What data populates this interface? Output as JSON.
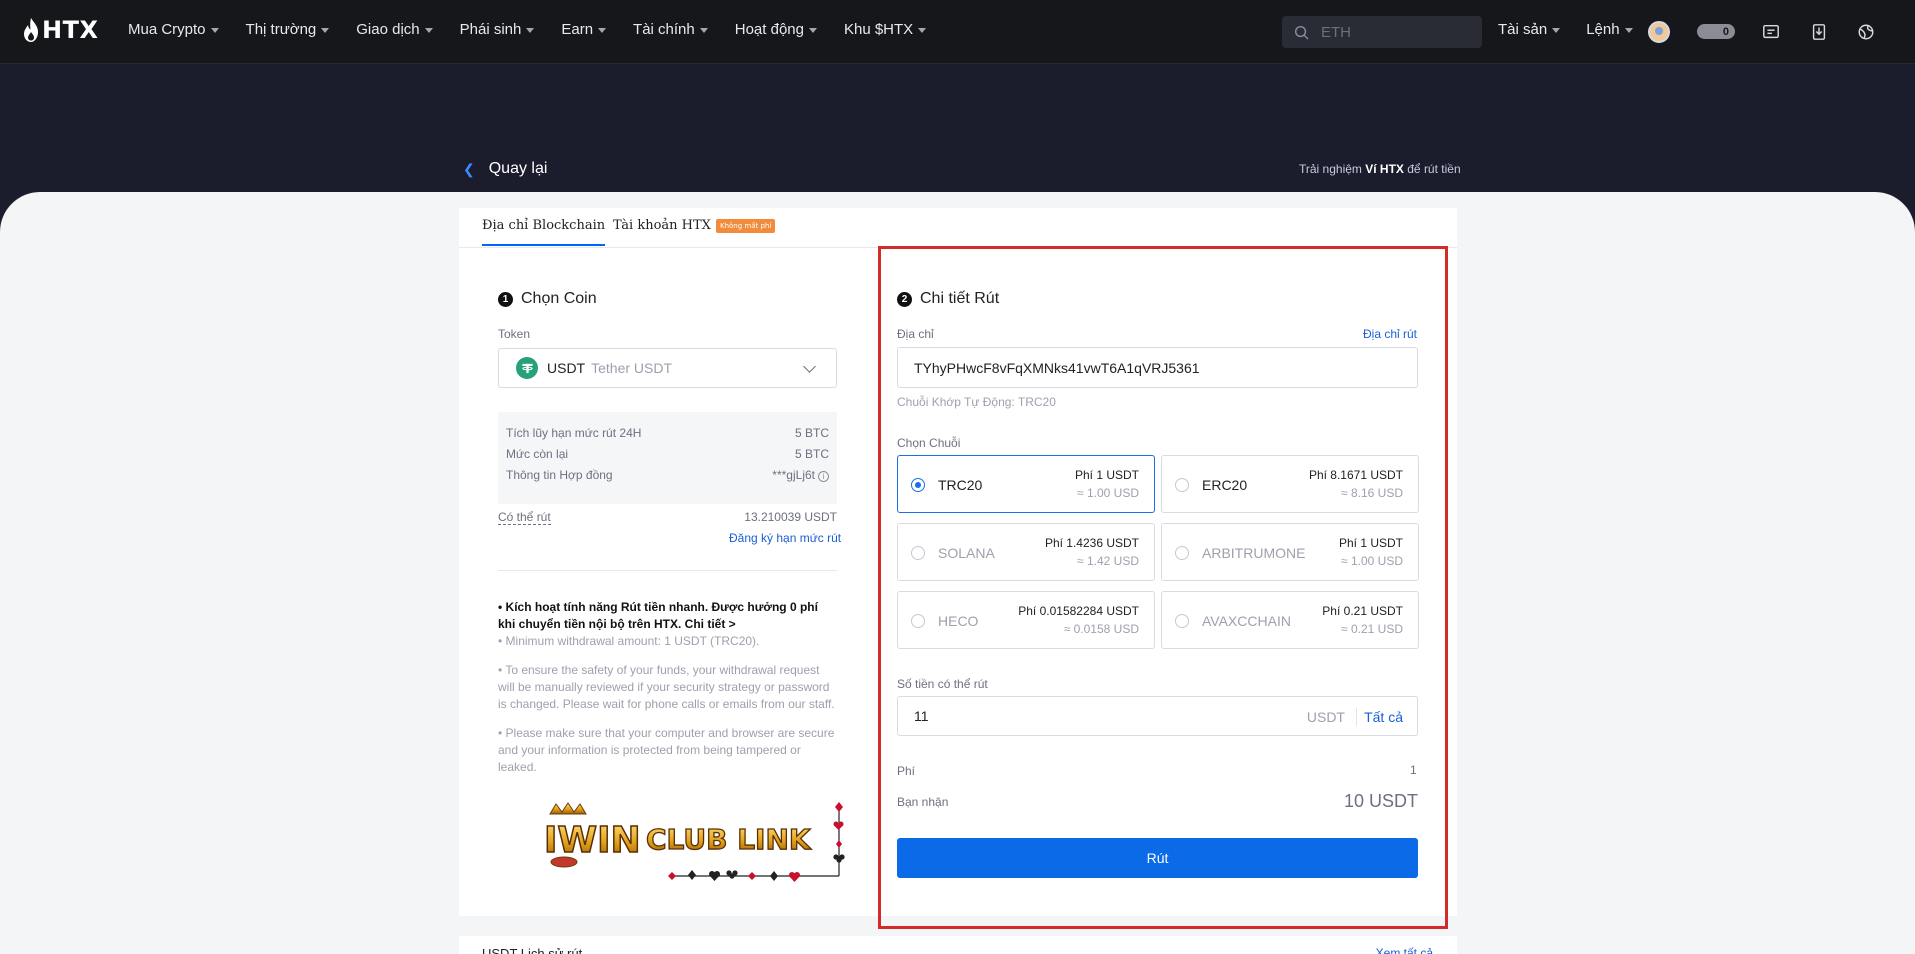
{
  "nav": {
    "logo": "HTX",
    "items": [
      "Mua Crypto",
      "Thị trường",
      "Giao dịch",
      "Phái sinh",
      "Earn",
      "Tài chính",
      "Hoạt động",
      "Khu $HTX"
    ],
    "search_placeholder": "ETH",
    "right_items": [
      "Tài sản",
      "Lệnh"
    ],
    "badge_count": "0"
  },
  "header": {
    "back_label": "Quay lại",
    "experience_prefix": "Trải nghiệm ",
    "experience_brand": "Ví HTX",
    "experience_suffix": " để rút tiền"
  },
  "tabs": {
    "blockchain": "Địa chỉ Blockchain",
    "htx_account": "Tài khoản HTX",
    "free_badge": "Không mất phí"
  },
  "coin_section": {
    "step": "1",
    "title": "Chọn Coin",
    "token_label": "Token",
    "token_symbol": "USDT",
    "token_name": "Tether USDT",
    "limits": [
      {
        "label": "Tích lũy hạn mức rút 24H",
        "value": "5 BTC"
      },
      {
        "label": "Mức còn lại",
        "value": "5 BTC"
      },
      {
        "label": "Thông tin Hợp đồng",
        "value": "***gjLj6t"
      }
    ],
    "available_label": "Có thể rút",
    "available_value": "13.210039 USDT",
    "register_link": "Đăng ký hạn mức rút",
    "notes": {
      "bold": "• Kích hoạt tính năng Rút tiền nhanh. Được hưởng 0 phí khi chuyển tiền nội bộ trên HTX. Chi tiết >",
      "min": "• Minimum withdrawal amount: 1 USDT (TRC20).",
      "safety": "• To ensure the safety of your funds, your withdrawal request will be manually reviewed if your security strategy or password is changed. Please wait for phone calls or emails from our staff.",
      "protect": "• Please make sure that your computer and browser are secure and your information is protected from being tampered or leaked."
    },
    "watermark_text": "IWIN CLUB LINK"
  },
  "detail_section": {
    "step": "2",
    "title": "Chi tiết Rút",
    "address_label": "Địa chỉ",
    "address_link": "Địa chỉ rút",
    "address_value": "TYhyPHwcF8vFqXMNks41vwT6A1qVRJ5361",
    "auto_match": "Chuỗi Khớp Tự Động: TRC20",
    "chain_label": "Chọn Chuỗi",
    "chains": [
      {
        "name": "TRC20",
        "fee": "Phí 1 USDT",
        "usd": "≈ 1.00 USD"
      },
      {
        "name": "ERC20",
        "fee": "Phí 8.1671 USDT",
        "usd": "≈ 8.16 USD"
      },
      {
        "name": "SOLANA",
        "fee": "Phí 1.4236 USDT",
        "usd": "≈ 1.42 USD"
      },
      {
        "name": "ARBITRUMONE",
        "fee": "Phí 1 USDT",
        "usd": "≈ 1.00 USD"
      },
      {
        "name": "HECO",
        "fee": "Phí 0.01582284 USDT",
        "usd": "≈ 0.0158 USD"
      },
      {
        "name": "AVAXCCHAIN",
        "fee": "Phí 0.21 USDT",
        "usd": "≈ 0.21 USD"
      }
    ],
    "amount_label": "Số tiền có thể rút",
    "amount_value": "11",
    "amount_unit": "USDT",
    "amount_all": "Tất cả",
    "fee_label": "Phí",
    "fee_value": "1",
    "receive_label": "Bạn nhận",
    "receive_value": "10 USDT",
    "submit_label": "Rút"
  },
  "history": {
    "title": "USDT Lịch sử rút",
    "link": "Xem tất cả"
  },
  "colors": {
    "accent": "#0a6ae8",
    "highlight_frame": "#d32a2a",
    "nav_bg": "#16171b",
    "banner_bg": "#1b1d2c"
  }
}
